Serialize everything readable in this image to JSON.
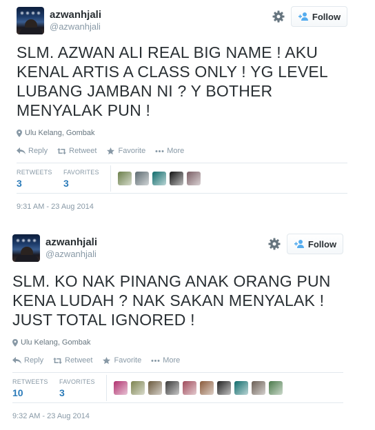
{
  "tweets": [
    {
      "display_name": "azwanhjali",
      "handle": "@azwanhjali",
      "follow_label": "Follow",
      "text": "SLM. AZWAN ALI REAL BIG NAME ! AKU KENAL ARTIS A CLASS ONLY ! YG LEVEL LUBANG JAMBAN NI ? Y BOTHER MENYALAK PUN !",
      "location": "Ulu Kelang, Gombak",
      "actions": {
        "reply": "Reply",
        "retweet": "Retweet",
        "favorite": "Favorite",
        "more": "More"
      },
      "retweets_label": "RETWEETS",
      "retweets": "3",
      "favorites_label": "FAVORITES",
      "favorites": "3",
      "favoriter_colors": [
        "#6b7f4a",
        "#5c6a70",
        "#0f6b6b",
        "#111111",
        "#7a5e64"
      ],
      "timestamp": "9:31 AM - 23 Aug 2014"
    },
    {
      "display_name": "azwanhjali",
      "handle": "@azwanhjali",
      "follow_label": "Follow",
      "text": "SLM. KO NAK PINANG ANAK ORANG PUN KENA LUDAH ? NAK SAKAN MENYALAK ! JUST TOTAL IGNORED !",
      "location": "Ulu Kelang, Gombak",
      "actions": {
        "reply": "Reply",
        "retweet": "Retweet",
        "favorite": "Favorite",
        "more": "More"
      },
      "retweets_label": "RETWEETS",
      "retweets": "10",
      "favorites_label": "FAVORITES",
      "favorites": "3",
      "favoriter_colors": [
        "#b0306e",
        "#7d8450",
        "#6b5a3e",
        "#3a3a3a",
        "#a04a5a",
        "#8a5a3a",
        "#222222",
        "#0f6b6b",
        "#6a5e54",
        "#4a7a4a"
      ],
      "timestamp": "9:32 AM - 23 Aug 2014"
    }
  ]
}
